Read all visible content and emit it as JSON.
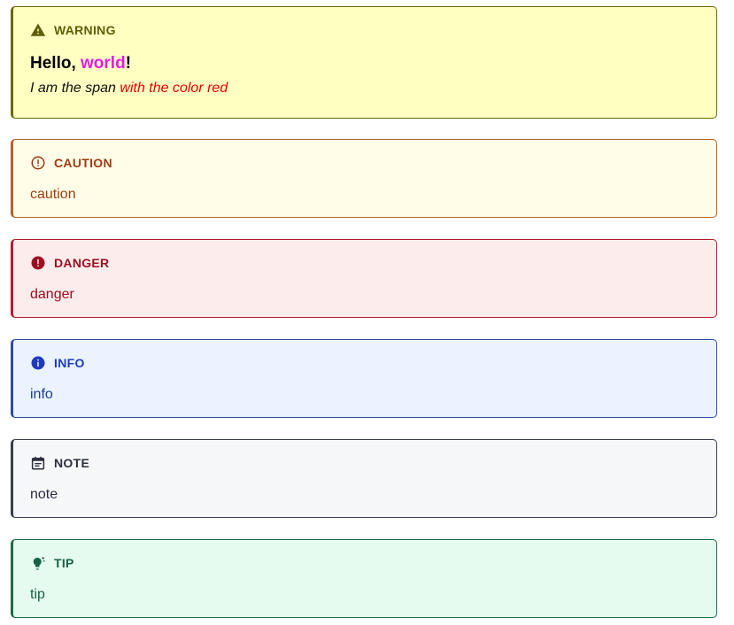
{
  "warning": {
    "title": "WARNING",
    "heading_prefix": "Hello, ",
    "heading_highlight": "world",
    "heading_suffix": "!",
    "span_text": "I am the span ",
    "span_red": "with the color red",
    "colors": {
      "background": "#ffffc2",
      "accent": "#5f5f0a",
      "highlight": "#e619e6",
      "red": "#e60000"
    },
    "icon": "warning-triangle-icon"
  },
  "caution": {
    "title": "CAUTION",
    "body": "caution",
    "colors": {
      "background": "#fffce8",
      "accent": "#9c3d10"
    },
    "icon": "exclamation-circle-outline-icon"
  },
  "danger": {
    "title": "DANGER",
    "body": "danger",
    "colors": {
      "background": "#fdecec",
      "accent": "#9c0f22"
    },
    "icon": "exclamation-circle-filled-icon"
  },
  "info": {
    "title": "INFO",
    "body": "info",
    "colors": {
      "background": "#eaf3ff",
      "accent": "#1d3bbd"
    },
    "icon": "info-circle-icon"
  },
  "note": {
    "title": "NOTE",
    "body": "note",
    "colors": {
      "background": "#f6f7f9",
      "accent": "#2a2f3c"
    },
    "icon": "calendar-note-icon"
  },
  "tip": {
    "title": "TIP",
    "body": "tip",
    "colors": {
      "background": "#e6fbef",
      "accent": "#176243"
    },
    "icon": "lightbulb-sparkle-icon"
  }
}
